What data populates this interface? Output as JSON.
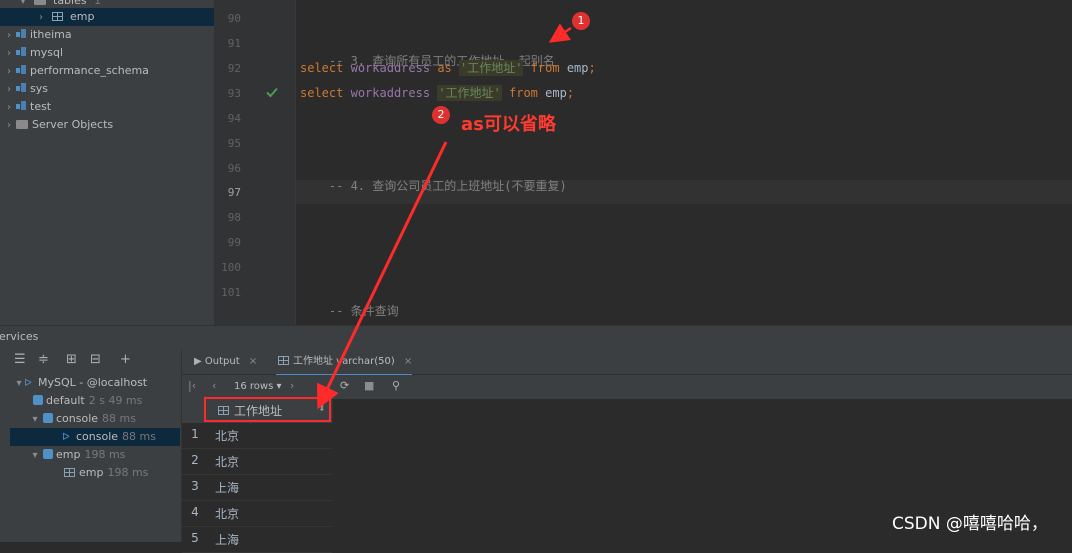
{
  "tree": {
    "items": [
      {
        "label": "tables",
        "extra": "1"
      },
      {
        "label": "emp"
      },
      {
        "label": "itheima"
      },
      {
        "label": "mysql"
      },
      {
        "label": "performance_schema"
      },
      {
        "label": "sys"
      },
      {
        "label": "test"
      },
      {
        "label": "Server Objects"
      }
    ]
  },
  "editor": {
    "lines": [
      {
        "num": "90"
      },
      {
        "num": "91",
        "comment": "-- 3. 查询所有员工的工作地址, 起别名"
      },
      {
        "num": "92",
        "kw1": "select",
        "col": "workaddress",
        "kw2": "as",
        "str": "'工作地址'",
        "kw3": "from",
        "table": "emp",
        "end": ";"
      },
      {
        "num": "93",
        "kw1": "select",
        "col": "workaddress",
        "str": "'工作地址'",
        "kw3": "from",
        "table": "emp",
        "end": ";"
      },
      {
        "num": "94"
      },
      {
        "num": "95"
      },
      {
        "num": "96",
        "comment": "-- 4. 查询公司员工的上班地址(不要重复)"
      },
      {
        "num": "97"
      },
      {
        "num": "98"
      },
      {
        "num": "99"
      },
      {
        "num": "100"
      },
      {
        "num": "101",
        "comment": "-- 条件查询"
      }
    ]
  },
  "services": {
    "title": "Services",
    "tree": [
      {
        "label": "MySQL - @localhost",
        "extra": ""
      },
      {
        "label": "default",
        "extra": "2 s 49 ms"
      },
      {
        "label": "console",
        "extra": "88 ms"
      },
      {
        "label": "console",
        "extra": "88 ms"
      },
      {
        "label": "emp",
        "extra": "198 ms"
      },
      {
        "label": "emp",
        "extra": "198 ms"
      }
    ],
    "tabs": [
      {
        "label": "Output"
      },
      {
        "label": "工作地址 varchar(50)"
      }
    ],
    "rows_label": "16 rows",
    "column_header": "工作地址",
    "rows": [
      {
        "n": "1",
        "v": "北京"
      },
      {
        "n": "2",
        "v": "北京"
      },
      {
        "n": "3",
        "v": "上海"
      },
      {
        "n": "4",
        "v": "北京"
      },
      {
        "n": "5",
        "v": "上海"
      }
    ]
  },
  "annotations": {
    "badge1": "1",
    "badge2": "2",
    "note": "as可以省略"
  },
  "watermark": "CSDN @嘻嘻哈哈，",
  "colors": {
    "annotation_red": "#ff2a2a",
    "keyword": "#cc7832",
    "identifier": "#9876aa",
    "string": "#6a8759"
  }
}
